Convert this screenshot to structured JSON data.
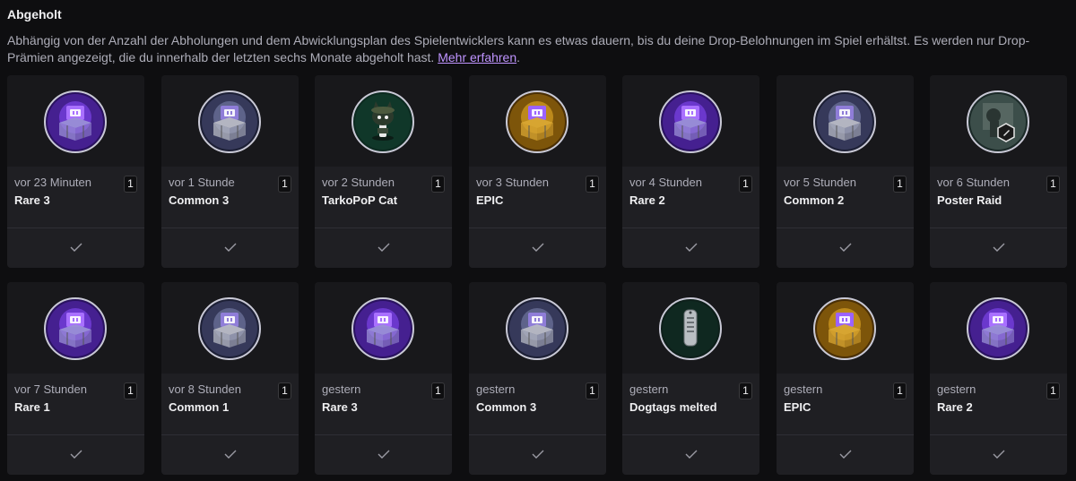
{
  "section": {
    "title": "Abgeholt",
    "description": "Abhängig von der Anzahl der Abholungen und dem Abwicklungsplan des Spielentwicklers kann es etwas dauern, bis du deine Drop-Belohnungen im Spiel erhältst. Es werden nur Drop-Prämien angezeigt, die du innerhalb der letzten sechs Monate abgeholt hast.",
    "link_label": "Mehr erfahren",
    "link_suffix": "."
  },
  "colors": {
    "rare": "#8a4dff",
    "common": "#7f87b3",
    "epic": "#f0b429",
    "special": "#2fa678"
  },
  "cards": [
    {
      "time": "vor 23 Minuten",
      "name": "Rare 3",
      "count": "1",
      "icon": "twitch-loot-crate-rare-icon"
    },
    {
      "time": "vor 1 Stunde",
      "name": "Common 3",
      "count": "1",
      "icon": "twitch-loot-crate-common-icon"
    },
    {
      "time": "vor 2 Stunden",
      "name": "TarkoPoP Cat",
      "count": "1",
      "icon": "tarkopop-cat-figure-icon"
    },
    {
      "time": "vor 3 Stunden",
      "name": "EPIC",
      "count": "1",
      "icon": "twitch-loot-crate-epic-icon"
    },
    {
      "time": "vor 4 Stunden",
      "name": "Rare 2",
      "count": "1",
      "icon": "twitch-loot-crate-rare-icon"
    },
    {
      "time": "vor 5 Stunden",
      "name": "Common 2",
      "count": "1",
      "icon": "twitch-loot-crate-common-icon"
    },
    {
      "time": "vor 6 Stunden",
      "name": "Poster Raid",
      "count": "1",
      "icon": "poster-raid-icon"
    },
    {
      "time": "vor 7 Stunden",
      "name": "Rare 1",
      "count": "1",
      "icon": "twitch-loot-crate-rare-icon"
    },
    {
      "time": "vor 8 Stunden",
      "name": "Common 1",
      "count": "1",
      "icon": "twitch-loot-crate-common-icon"
    },
    {
      "time": "gestern",
      "name": "Rare 3",
      "count": "1",
      "icon": "twitch-loot-crate-rare-icon"
    },
    {
      "time": "gestern",
      "name": "Common 3",
      "count": "1",
      "icon": "twitch-loot-crate-common-icon"
    },
    {
      "time": "gestern",
      "name": "Dogtags melted",
      "count": "1",
      "icon": "dogtags-icon"
    },
    {
      "time": "gestern",
      "name": "EPIC",
      "count": "1",
      "icon": "twitch-loot-crate-epic-icon"
    },
    {
      "time": "gestern",
      "name": "Rare 2",
      "count": "1",
      "icon": "twitch-loot-crate-rare-icon"
    }
  ]
}
